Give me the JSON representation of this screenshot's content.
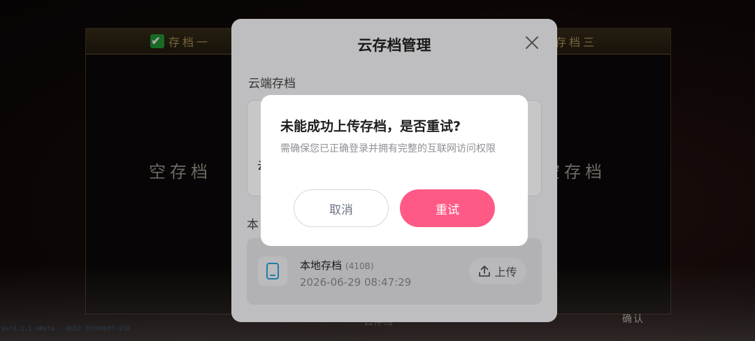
{
  "background": {
    "slot1_title": "存档一",
    "slot1_empty": "空存档",
    "slot3_title": "存档三",
    "slot3_empty": "空存档",
    "confirm_label": "确认",
    "bottom_label": "云存档",
    "version_text": "Ver4.1.1  ◎Beta  · 8852 20260607-23A"
  },
  "panel": {
    "title": "云存档管理",
    "cloud_section_label": "云端存档",
    "cloud_card_text": "云",
    "local_section_label": "本",
    "local_save": {
      "name": "本地存档",
      "size": "(410B)",
      "date": "2026-06-29 08:47:29",
      "upload_label": "上传"
    }
  },
  "dialog": {
    "title": "未能成功上传存档，是否重试?",
    "message": "需确保您已正确登录并拥有完整的互联网访问权限",
    "cancel_label": "取消",
    "retry_label": "重试"
  },
  "colors": {
    "accent": "#ff5a86",
    "local_icon": "#2aa0d8"
  }
}
